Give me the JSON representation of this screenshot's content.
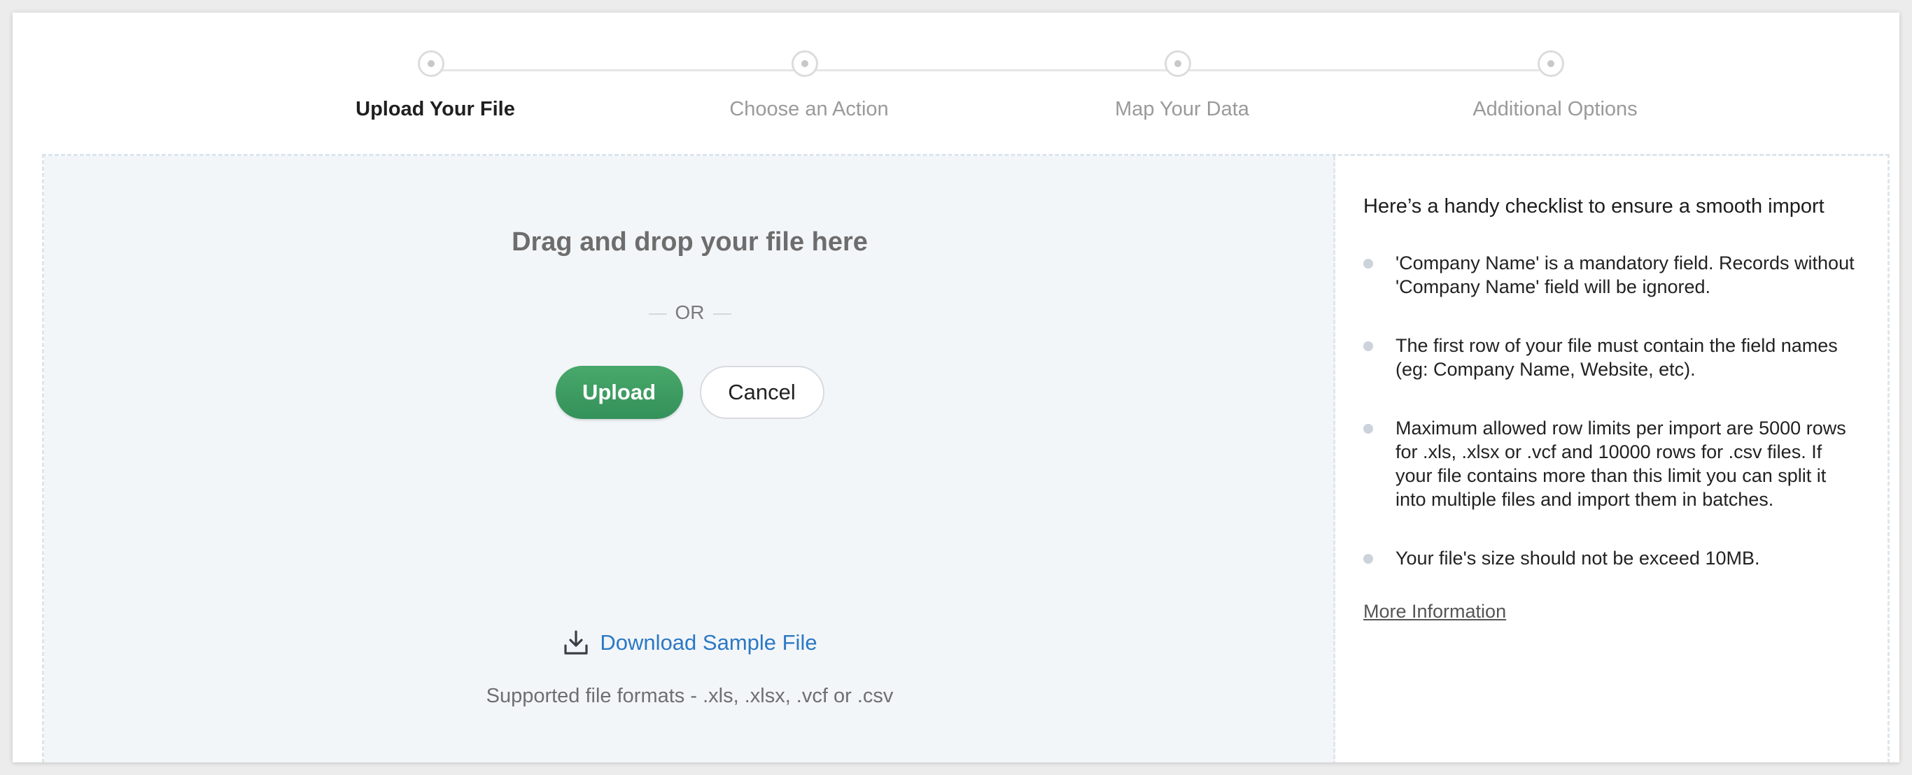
{
  "stepper": {
    "steps": [
      {
        "label": "Upload Your File",
        "active": true
      },
      {
        "label": "Choose an Action",
        "active": false
      },
      {
        "label": "Map Your Data",
        "active": false
      },
      {
        "label": "Additional Options",
        "active": false
      }
    ]
  },
  "dropzone": {
    "title": "Drag and drop your file here",
    "or_text": "OR",
    "upload_label": "Upload",
    "cancel_label": "Cancel",
    "download_label": "Download Sample File",
    "download_icon": "download-icon",
    "formats_text": "Supported file formats - .xls, .xlsx, .vcf or .csv"
  },
  "checklist": {
    "title": "Here’s a handy checklist to ensure a smooth import",
    "items": [
      "'Company Name' is a mandatory field. Records without 'Company Name' field will be ignored.",
      "The first row of your file must contain the field names (eg: Company Name, Website, etc).",
      "Maximum allowed row limits per import are 5000 rows for .xls, .xlsx or .vcf and 10000 rows for .csv files. If your file contains more than this limit you can split it into multiple files and import them in batches.",
      "Your file's size should not be exceed 10MB."
    ],
    "more_info_label": "More Information"
  },
  "colors": {
    "upload_button": "#3d9d62",
    "link": "#2b78c5",
    "dropzone_bg": "#f3f6f9"
  }
}
